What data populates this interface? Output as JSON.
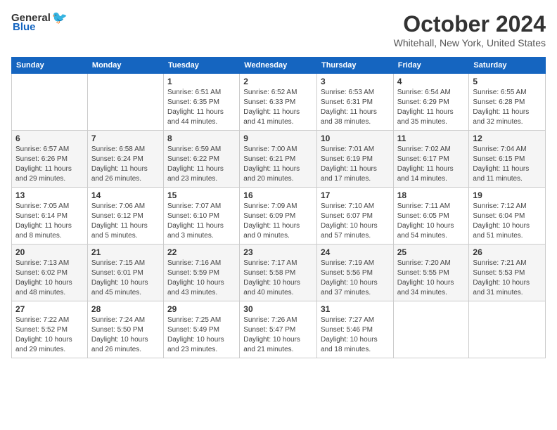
{
  "header": {
    "logo_general": "General",
    "logo_blue": "Blue",
    "title": "October 2024",
    "subtitle": "Whitehall, New York, United States"
  },
  "calendar": {
    "days_of_week": [
      "Sunday",
      "Monday",
      "Tuesday",
      "Wednesday",
      "Thursday",
      "Friday",
      "Saturday"
    ],
    "weeks": [
      [
        {
          "day": "",
          "empty": true
        },
        {
          "day": "",
          "empty": true
        },
        {
          "day": "1",
          "line1": "Sunrise: 6:51 AM",
          "line2": "Sunset: 6:35 PM",
          "line3": "Daylight: 11 hours",
          "line4": "and 44 minutes."
        },
        {
          "day": "2",
          "line1": "Sunrise: 6:52 AM",
          "line2": "Sunset: 6:33 PM",
          "line3": "Daylight: 11 hours",
          "line4": "and 41 minutes."
        },
        {
          "day": "3",
          "line1": "Sunrise: 6:53 AM",
          "line2": "Sunset: 6:31 PM",
          "line3": "Daylight: 11 hours",
          "line4": "and 38 minutes."
        },
        {
          "day": "4",
          "line1": "Sunrise: 6:54 AM",
          "line2": "Sunset: 6:29 PM",
          "line3": "Daylight: 11 hours",
          "line4": "and 35 minutes."
        },
        {
          "day": "5",
          "line1": "Sunrise: 6:55 AM",
          "line2": "Sunset: 6:28 PM",
          "line3": "Daylight: 11 hours",
          "line4": "and 32 minutes."
        }
      ],
      [
        {
          "day": "6",
          "line1": "Sunrise: 6:57 AM",
          "line2": "Sunset: 6:26 PM",
          "line3": "Daylight: 11 hours",
          "line4": "and 29 minutes."
        },
        {
          "day": "7",
          "line1": "Sunrise: 6:58 AM",
          "line2": "Sunset: 6:24 PM",
          "line3": "Daylight: 11 hours",
          "line4": "and 26 minutes."
        },
        {
          "day": "8",
          "line1": "Sunrise: 6:59 AM",
          "line2": "Sunset: 6:22 PM",
          "line3": "Daylight: 11 hours",
          "line4": "and 23 minutes."
        },
        {
          "day": "9",
          "line1": "Sunrise: 7:00 AM",
          "line2": "Sunset: 6:21 PM",
          "line3": "Daylight: 11 hours",
          "line4": "and 20 minutes."
        },
        {
          "day": "10",
          "line1": "Sunrise: 7:01 AM",
          "line2": "Sunset: 6:19 PM",
          "line3": "Daylight: 11 hours",
          "line4": "and 17 minutes."
        },
        {
          "day": "11",
          "line1": "Sunrise: 7:02 AM",
          "line2": "Sunset: 6:17 PM",
          "line3": "Daylight: 11 hours",
          "line4": "and 14 minutes."
        },
        {
          "day": "12",
          "line1": "Sunrise: 7:04 AM",
          "line2": "Sunset: 6:15 PM",
          "line3": "Daylight: 11 hours",
          "line4": "and 11 minutes."
        }
      ],
      [
        {
          "day": "13",
          "line1": "Sunrise: 7:05 AM",
          "line2": "Sunset: 6:14 PM",
          "line3": "Daylight: 11 hours",
          "line4": "and 8 minutes."
        },
        {
          "day": "14",
          "line1": "Sunrise: 7:06 AM",
          "line2": "Sunset: 6:12 PM",
          "line3": "Daylight: 11 hours",
          "line4": "and 5 minutes."
        },
        {
          "day": "15",
          "line1": "Sunrise: 7:07 AM",
          "line2": "Sunset: 6:10 PM",
          "line3": "Daylight: 11 hours",
          "line4": "and 3 minutes."
        },
        {
          "day": "16",
          "line1": "Sunrise: 7:09 AM",
          "line2": "Sunset: 6:09 PM",
          "line3": "Daylight: 11 hours",
          "line4": "and 0 minutes."
        },
        {
          "day": "17",
          "line1": "Sunrise: 7:10 AM",
          "line2": "Sunset: 6:07 PM",
          "line3": "Daylight: 10 hours",
          "line4": "and 57 minutes."
        },
        {
          "day": "18",
          "line1": "Sunrise: 7:11 AM",
          "line2": "Sunset: 6:05 PM",
          "line3": "Daylight: 10 hours",
          "line4": "and 54 minutes."
        },
        {
          "day": "19",
          "line1": "Sunrise: 7:12 AM",
          "line2": "Sunset: 6:04 PM",
          "line3": "Daylight: 10 hours",
          "line4": "and 51 minutes."
        }
      ],
      [
        {
          "day": "20",
          "line1": "Sunrise: 7:13 AM",
          "line2": "Sunset: 6:02 PM",
          "line3": "Daylight: 10 hours",
          "line4": "and 48 minutes."
        },
        {
          "day": "21",
          "line1": "Sunrise: 7:15 AM",
          "line2": "Sunset: 6:01 PM",
          "line3": "Daylight: 10 hours",
          "line4": "and 45 minutes."
        },
        {
          "day": "22",
          "line1": "Sunrise: 7:16 AM",
          "line2": "Sunset: 5:59 PM",
          "line3": "Daylight: 10 hours",
          "line4": "and 43 minutes."
        },
        {
          "day": "23",
          "line1": "Sunrise: 7:17 AM",
          "line2": "Sunset: 5:58 PM",
          "line3": "Daylight: 10 hours",
          "line4": "and 40 minutes."
        },
        {
          "day": "24",
          "line1": "Sunrise: 7:19 AM",
          "line2": "Sunset: 5:56 PM",
          "line3": "Daylight: 10 hours",
          "line4": "and 37 minutes."
        },
        {
          "day": "25",
          "line1": "Sunrise: 7:20 AM",
          "line2": "Sunset: 5:55 PM",
          "line3": "Daylight: 10 hours",
          "line4": "and 34 minutes."
        },
        {
          "day": "26",
          "line1": "Sunrise: 7:21 AM",
          "line2": "Sunset: 5:53 PM",
          "line3": "Daylight: 10 hours",
          "line4": "and 31 minutes."
        }
      ],
      [
        {
          "day": "27",
          "line1": "Sunrise: 7:22 AM",
          "line2": "Sunset: 5:52 PM",
          "line3": "Daylight: 10 hours",
          "line4": "and 29 minutes."
        },
        {
          "day": "28",
          "line1": "Sunrise: 7:24 AM",
          "line2": "Sunset: 5:50 PM",
          "line3": "Daylight: 10 hours",
          "line4": "and 26 minutes."
        },
        {
          "day": "29",
          "line1": "Sunrise: 7:25 AM",
          "line2": "Sunset: 5:49 PM",
          "line3": "Daylight: 10 hours",
          "line4": "and 23 minutes."
        },
        {
          "day": "30",
          "line1": "Sunrise: 7:26 AM",
          "line2": "Sunset: 5:47 PM",
          "line3": "Daylight: 10 hours",
          "line4": "and 21 minutes."
        },
        {
          "day": "31",
          "line1": "Sunrise: 7:27 AM",
          "line2": "Sunset: 5:46 PM",
          "line3": "Daylight: 10 hours",
          "line4": "and 18 minutes."
        },
        {
          "day": "",
          "empty": true
        },
        {
          "day": "",
          "empty": true
        }
      ]
    ]
  }
}
